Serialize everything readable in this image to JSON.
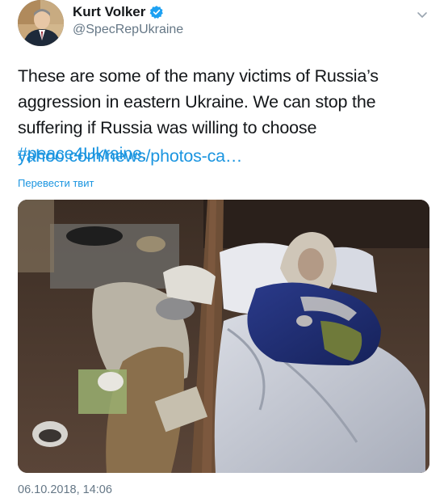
{
  "author": {
    "display_name": "Kurt Volker",
    "handle": "@SpecRepUkraine",
    "verified": true
  },
  "tweet": {
    "text_before_hashtag": "These are some of the many victims of Russia’s aggression in eastern Ukraine. We can stop the suffering if Russia was willing to choose ",
    "hashtag": "#peace4Ukraine",
    "text_after_hashtag": ".",
    "link_text": "yahoo.com/news/photos-ca…",
    "translate_label": "Перевести твит",
    "timestamp": "06.10.2018, 14:06"
  },
  "colors": {
    "link": "#1b95e0",
    "secondary_text": "#657786",
    "verified_badge": "#1da1f2"
  },
  "icons": {
    "verified": "verified-badge-icon",
    "menu": "chevron-down-icon"
  }
}
